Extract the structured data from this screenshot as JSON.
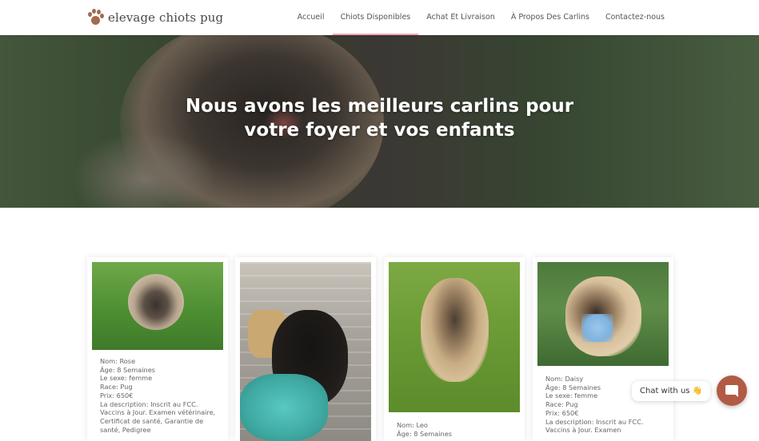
{
  "header": {
    "logo_text": "elevage chiots pug",
    "nav": [
      {
        "label": "Accueil"
      },
      {
        "label": "Chiots Disponibles"
      },
      {
        "label": "Achat Et Livraison"
      },
      {
        "label": "À Propos Des Carlins"
      },
      {
        "label": "Contactez-nous"
      }
    ],
    "active_nav": "Chiots Disponibles"
  },
  "hero": {
    "title_line1": "Nous avons les meilleurs carlins pour",
    "title_line2": "votre foyer et vos enfants"
  },
  "puppies": [
    {
      "name": "Nom: Rose",
      "age": "Âge: 8 Semaines",
      "sex": "Le sexe: femme",
      "breed": "Race: Pug",
      "price": "Prix: 650€",
      "description": "La description: Inscrit au FCC. Vaccins à Jour. Examen vétérinaire, Certificat de santé, Garantie de santé, Pedigree"
    },
    {
      "name": "",
      "age": "",
      "sex": "",
      "breed": "",
      "price": "",
      "description": ""
    },
    {
      "name": "Nom: Leo",
      "age": "Âge: 8 Semaines",
      "sex": "",
      "breed": "",
      "price": "",
      "description": ""
    },
    {
      "name": "Nom: Daisy",
      "age": "Âge: 8 Semaines",
      "sex": "Le sexe: femme",
      "breed": "Race: Pug",
      "price": "Prix: 650€",
      "description": "La description: Inscrit au FCC. Vaccins à Jour. Examen"
    }
  ],
  "chat": {
    "label": "Chat with us 👋"
  },
  "colors": {
    "nav_active_underline": "#f2a9b7",
    "chat_button": "#b35a45",
    "logo_paw": "#a66a4f"
  }
}
